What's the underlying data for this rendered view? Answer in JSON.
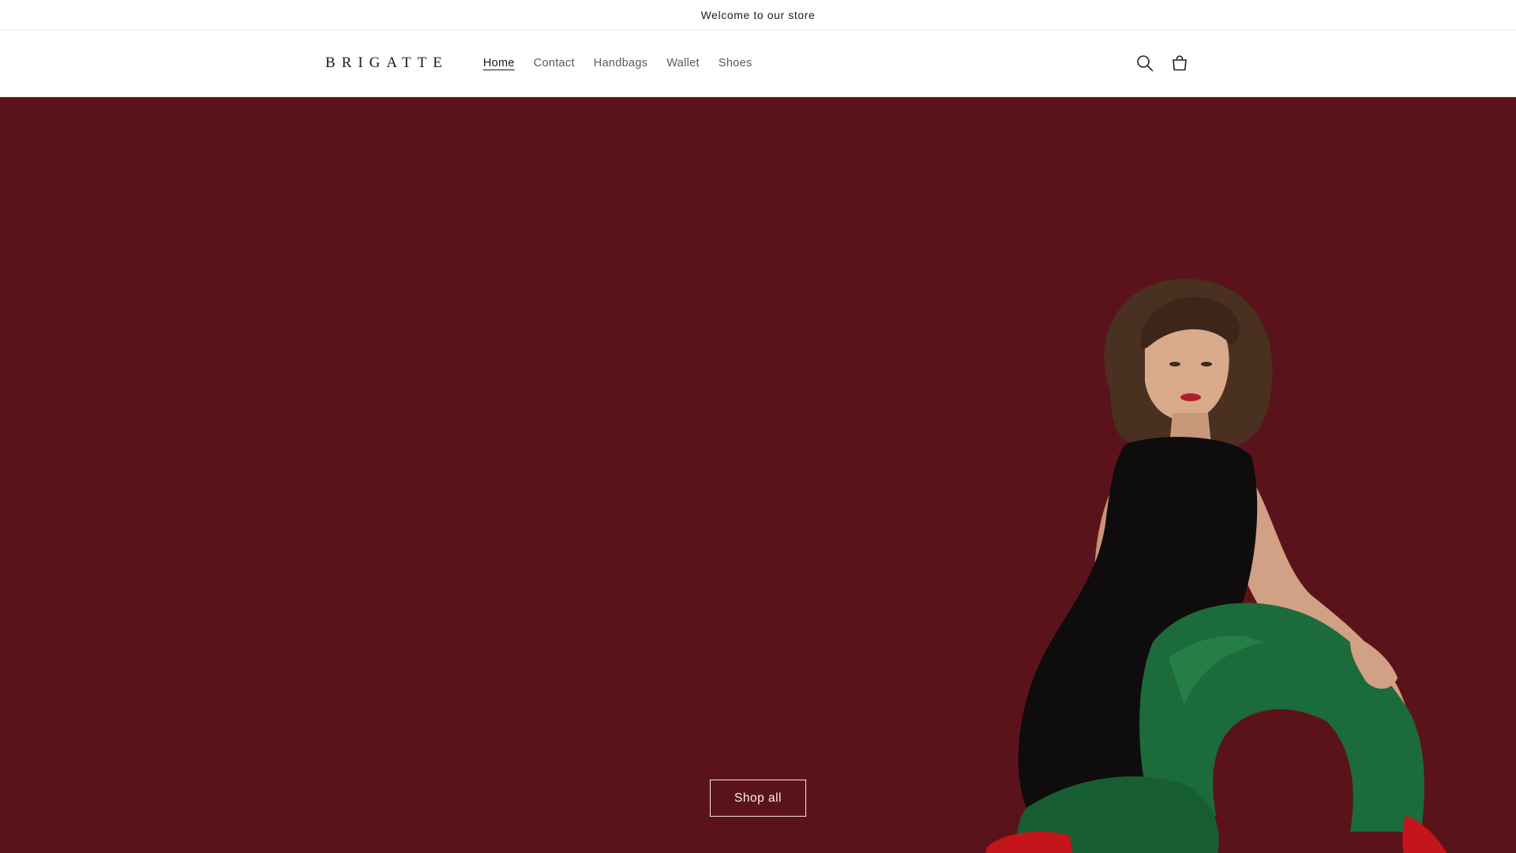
{
  "announcement": {
    "text": "Welcome to our store"
  },
  "header": {
    "logo": "BRIGATTE",
    "nav": [
      {
        "label": "Home",
        "active": true
      },
      {
        "label": "Contact",
        "active": false
      },
      {
        "label": "Handbags",
        "active": false
      },
      {
        "label": "Wallet",
        "active": false
      },
      {
        "label": "Shoes",
        "active": false
      }
    ],
    "icons": [
      "search-icon",
      "cart-icon"
    ]
  },
  "hero": {
    "background_color": "#5b131b",
    "button_label": "Shop all",
    "image": "model-seated-black-dress-green-tights-red-heels"
  }
}
